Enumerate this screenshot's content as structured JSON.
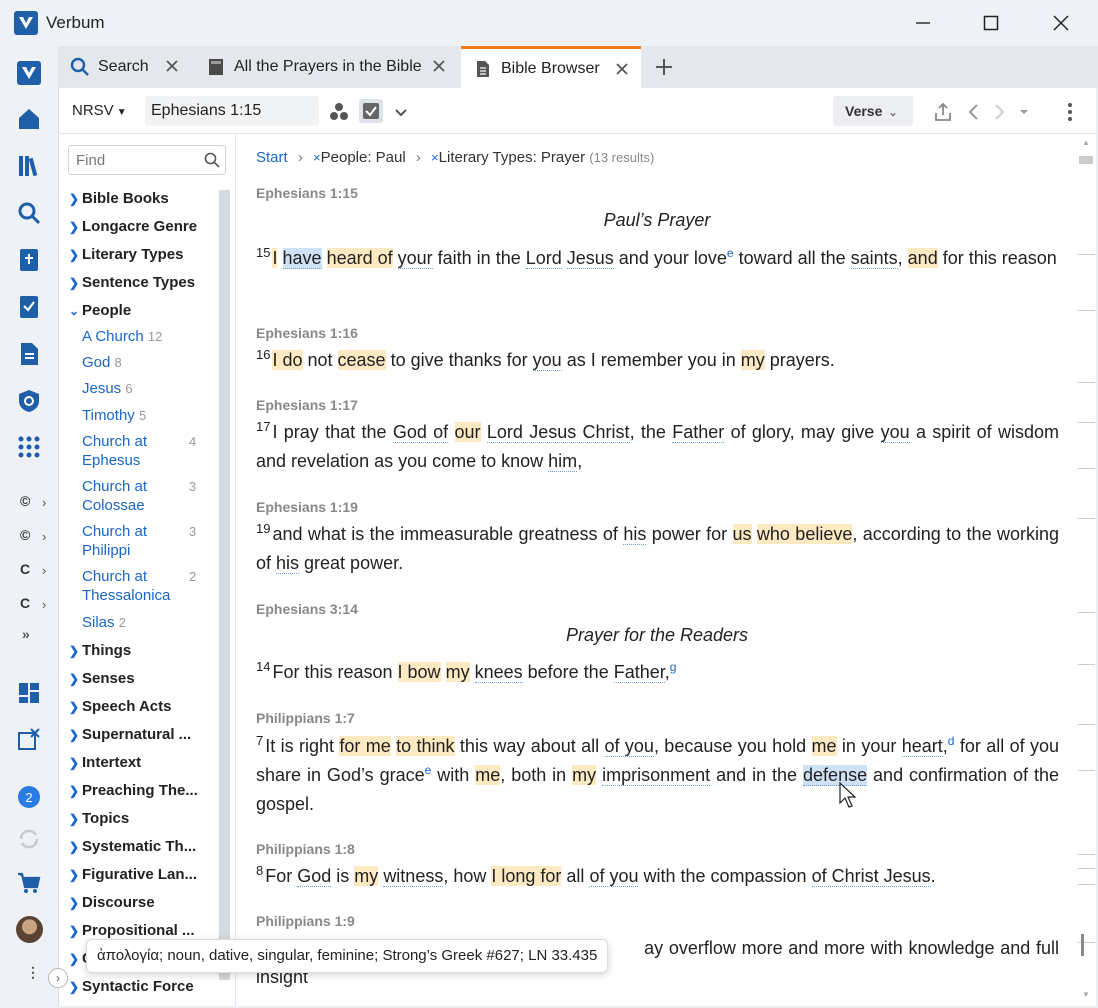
{
  "app": {
    "name": "Verbum"
  },
  "tabs": [
    {
      "label": "Search",
      "icon": "search-icon"
    },
    {
      "label": "All the Prayers in the Bible",
      "icon": "book-icon"
    },
    {
      "label": "Bible Browser",
      "icon": "document-icon",
      "active": true
    }
  ],
  "toolbar": {
    "version": "NRSV",
    "reference": "Ephesians 1:15",
    "view_mode": "Verse"
  },
  "sidebar": {
    "find_placeholder": "Find",
    "facets_top": [
      "Bible Books",
      "Longacre Genre",
      "Literary Types",
      "Sentence Types"
    ],
    "people_label": "People",
    "people": [
      {
        "name": "A Church",
        "count": "12"
      },
      {
        "name": "God",
        "count": "8"
      },
      {
        "name": "Jesus",
        "count": "6"
      },
      {
        "name": "Timothy",
        "count": "5"
      },
      {
        "name": "Church at Ephesus",
        "line1": "Church at",
        "line2": "Ephesus",
        "count": "4"
      },
      {
        "name": "Church at Colossae",
        "line1": "Church at",
        "line2": "Colossae",
        "count": "3"
      },
      {
        "name": "Church at Philippi",
        "line1": "Church at",
        "line2": "Philippi",
        "count": "3"
      },
      {
        "name": "Church at Thessalonica",
        "line1": "Church at",
        "line2": "Thessalonica",
        "count": "2"
      },
      {
        "name": "Silas",
        "count": "2"
      }
    ],
    "facets_bottom": [
      "Things",
      "Senses",
      "Speech Acts",
      "Supernatural ...",
      "Intertext",
      "Preaching The...",
      "Topics",
      "Systematic Th...",
      "Figurative Lan...",
      "Discourse",
      "Propositional ...",
      "C",
      "Syntactic Force"
    ]
  },
  "breadcrumb": {
    "start": "Start",
    "filter1": "People: Paul",
    "filter2": "Literary Types: Prayer",
    "results": "(13 results)"
  },
  "passages": {
    "eph1_15": {
      "ref": "Ephesians 1:15",
      "heading": "Paul’s Prayer",
      "num": "15"
    },
    "eph1_16": {
      "ref": "Ephesians 1:16",
      "num": "16"
    },
    "eph1_17": {
      "ref": "Ephesians 1:17",
      "num": "17"
    },
    "eph1_19": {
      "ref": "Ephesians 1:19",
      "num": "19"
    },
    "eph3_14": {
      "ref": "Ephesians 3:14",
      "heading": "Prayer for the Readers",
      "num": "14"
    },
    "phil1_7": {
      "ref": "Philippians 1:7",
      "num": "7"
    },
    "phil1_8": {
      "ref": "Philippians 1:8",
      "num": "8"
    },
    "phil1_9": {
      "ref": "Philippians 1:9"
    }
  },
  "tooltip": {
    "text": "ἀπολογία; noun, dative, singular, feminine; Strong’s Greek #627; LN 33.435"
  },
  "rail": {
    "badge": "2"
  },
  "colors": {
    "accent": "#1a66c8",
    "tab_active": "#f07a1a",
    "highlight": "#fde9c2"
  }
}
